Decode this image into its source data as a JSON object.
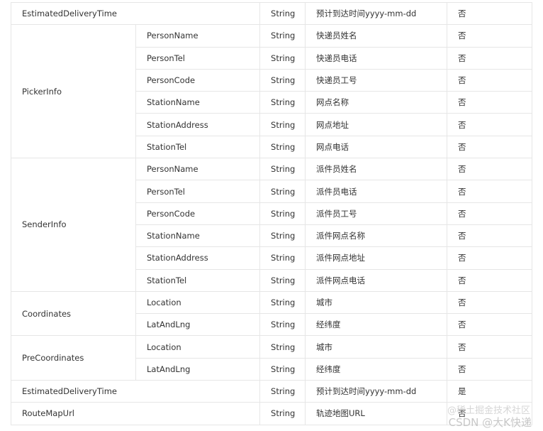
{
  "table": {
    "top_row": {
      "name": "EstimatedDeliveryTime",
      "type": "String",
      "desc": "预计到达时间yyyy-mm-dd",
      "required": "否"
    },
    "groups": [
      {
        "name": "PickerInfo",
        "rows": [
          {
            "field": "PersonName",
            "type": "String",
            "desc": "快递员姓名",
            "required": "否"
          },
          {
            "field": "PersonTel",
            "type": "String",
            "desc": "快递员电话",
            "required": "否"
          },
          {
            "field": "PersonCode",
            "type": "String",
            "desc": "快递员工号",
            "required": "否"
          },
          {
            "field": "StationName",
            "type": "String",
            "desc": "网点名称",
            "required": "否"
          },
          {
            "field": "StationAddress",
            "type": "String",
            "desc": "网点地址",
            "required": "否"
          },
          {
            "field": "StationTel",
            "type": "String",
            "desc": "网点电话",
            "required": "否"
          }
        ]
      },
      {
        "name": "SenderInfo",
        "rows": [
          {
            "field": "PersonName",
            "type": "String",
            "desc": "派件员姓名",
            "required": "否"
          },
          {
            "field": "PersonTel",
            "type": "String",
            "desc": "派件员电话",
            "required": "否"
          },
          {
            "field": "PersonCode",
            "type": "String",
            "desc": "派件员工号",
            "required": "否"
          },
          {
            "field": "StationName",
            "type": "String",
            "desc": "派件网点名称",
            "required": "否"
          },
          {
            "field": "StationAddress",
            "type": "String",
            "desc": "派件网点地址",
            "required": "否"
          },
          {
            "field": "StationTel",
            "type": "String",
            "desc": "派件网点电话",
            "required": "否"
          }
        ]
      },
      {
        "name": "Coordinates",
        "rows": [
          {
            "field": "Location",
            "type": "String",
            "desc": "城市",
            "required": "否"
          },
          {
            "field": "LatAndLng",
            "type": "String",
            "desc": "经纬度",
            "required": "否"
          }
        ]
      },
      {
        "name": "PreCoordinates",
        "rows": [
          {
            "field": "Location",
            "type": "String",
            "desc": "城市",
            "required": "否"
          },
          {
            "field": "LatAndLng",
            "type": "String",
            "desc": "经纬度",
            "required": "否"
          }
        ]
      }
    ],
    "bottom_rows": [
      {
        "name": "EstimatedDeliveryTime",
        "type": "String",
        "desc": "预计到达时间yyyy-mm-dd",
        "required": "是"
      },
      {
        "name": "RouteMapUrl",
        "type": "String",
        "desc": "轨迹地图URL",
        "required": "否"
      }
    ]
  },
  "watermark": {
    "line1": "@稀土掘金技术社区",
    "line2": "CSDN @大K快递"
  }
}
